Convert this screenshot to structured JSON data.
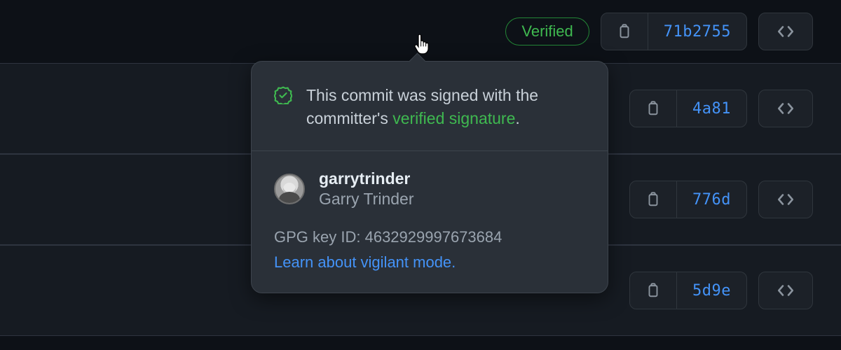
{
  "badge": {
    "label": "Verified"
  },
  "commits": [
    {
      "hash": "71b2755"
    },
    {
      "hash": "4a81"
    },
    {
      "hash": "776d"
    },
    {
      "hash": "5d9e"
    }
  ],
  "popover": {
    "msg_pre": "This commit was signed with the committer's ",
    "msg_sig": "verified signature",
    "msg_post": ".",
    "username": "garrytrinder",
    "fullname": "Garry Trinder",
    "gpg_label": "GPG key ID: ",
    "gpg_id": "4632929997673684",
    "learn": "Learn about vigilant mode."
  }
}
